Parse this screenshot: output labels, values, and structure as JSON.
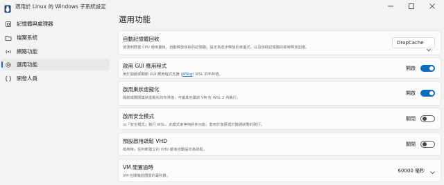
{
  "window": {
    "title": "適用於 Linux 的 Windows 子系統設定",
    "accent": "#0f6cbd"
  },
  "sidebar": {
    "items": [
      {
        "label": "記憶體與處理器",
        "icon": "memory-icon"
      },
      {
        "label": "檔案系統",
        "icon": "folder-icon"
      },
      {
        "label": "網路功能",
        "icon": "network-icon"
      },
      {
        "label": "選用功能",
        "icon": "gear-icon",
        "active": true
      },
      {
        "label": "開發人員",
        "icon": "code-icon"
      }
    ]
  },
  "main": {
    "title": "選用功能",
    "cards": [
      {
        "title": "自動記憶體回收",
        "desc": "偵測到閒置 CPU 使用量後，自動釋放快取的記憶體。設定為逐步釋放的漸進式，以及快取記憶體的即時釋放回復。",
        "control": "dropdown",
        "value": "DropCache"
      },
      {
        "title": "啟用 GUI 應用程式",
        "desc_before": "用於開啟或關閉 GUI 應用程式支援 (",
        "desc_link": "WSLg",
        "desc_after": ") WSL 的布林值。",
        "control": "toggle",
        "state": "開啟",
        "on": true
      },
      {
        "title": "啟用巢狀虛擬化",
        "desc": "開啟或關閉巢狀虛擬化的布林值，可讓其他巢狀 VM 在 WSL 2 內執行。",
        "control": "toggle",
        "state": "開啟",
        "on": true
      },
      {
        "title": "啟用安全模式",
        "desc": "以「安全模式」執行 WSL，此模式會停用許多功能，套用於復原處於錯誤狀態的發行。",
        "control": "toggle",
        "state": "關閉",
        "on": false
      },
      {
        "title": "預設啟用疏鬆 VHD",
        "desc": "啟用時，任何新建立的 VHD 都會自動設定為疏鬆。",
        "control": "toggle",
        "state": "關閉",
        "on": false
      },
      {
        "title": "VM 閒置逾時",
        "desc": "VM 在關機前閒置的毫秒數。",
        "control": "spinner",
        "value": "60000 毫秒"
      }
    ]
  }
}
